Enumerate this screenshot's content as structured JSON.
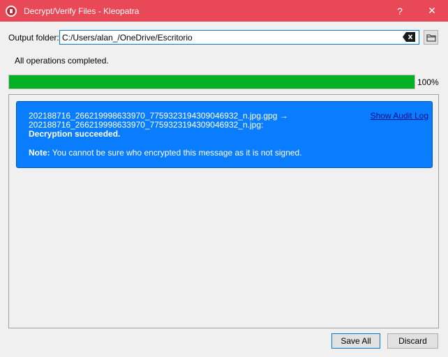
{
  "window": {
    "title": "Decrypt/Verify Files - Kleopatra",
    "help_glyph": "?",
    "close_glyph": "✕"
  },
  "output": {
    "label": "Output folder:",
    "value": "C:/Users/alan_/OneDrive/Escritorio"
  },
  "status": {
    "message": "All operations completed."
  },
  "progress": {
    "value": 100,
    "label": "100%"
  },
  "result": {
    "file_line_1": "202188716_266219998633970_7759323194309046932_n.jpg.gpg →",
    "file_line_2": "202188716_266219998633970_7759323194309046932_n.jpg:",
    "result_text": "Decryption succeeded.",
    "note_label": "Note:",
    "note_text": " You cannot be sure who encrypted this message as it is not signed.",
    "audit_link": "Show Audit Log"
  },
  "buttons": {
    "save_all": "Save All",
    "discard": "Discard"
  },
  "colors": {
    "titlebar": "#e94856",
    "progress": "#06b025",
    "card": "#0a7dff"
  }
}
